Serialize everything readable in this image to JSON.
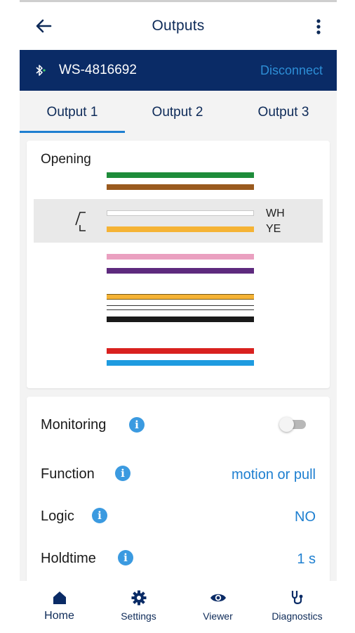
{
  "app_bar": {
    "title": "Outputs",
    "back_icon": "arrow-left-icon",
    "menu_icon": "more-vertical-icon"
  },
  "device": {
    "name": "WS-4816692",
    "action": "Disconnect",
    "icon": "bluetooth-icon"
  },
  "tabs": [
    {
      "label": "Output 1",
      "selected": true
    },
    {
      "label": "Output 2",
      "selected": false
    },
    {
      "label": "Output 3",
      "selected": false
    }
  ],
  "wiring": {
    "title": "Opening",
    "highlighted_labels": [
      "WH",
      "YE"
    ],
    "wire_colors": {
      "green": "#1e8c3a",
      "brown": "#9a5a1e",
      "white": "#ffffff",
      "yellow": "#f5b335",
      "pink": "#eaa0c0",
      "violet": "#5e2a7e",
      "black": "#1a1a1a",
      "red": "#d9211f",
      "blue": "#1e9be0"
    }
  },
  "settings": {
    "monitoring": {
      "label": "Monitoring",
      "enabled": false
    },
    "function": {
      "label": "Function",
      "value": "motion or pull"
    },
    "logic": {
      "label": "Logic",
      "value": "NO"
    },
    "holdtime": {
      "label": "Holdtime",
      "value": "1 s"
    }
  },
  "bottom_nav": [
    {
      "label": "Home",
      "icon": "home-icon",
      "active": true
    },
    {
      "label": "Settings",
      "icon": "gear-icon",
      "active": false
    },
    {
      "label": "Viewer",
      "icon": "eye-icon",
      "active": false
    },
    {
      "label": "Diagnostics",
      "icon": "stethoscope-icon",
      "active": false
    }
  ],
  "colors": {
    "primary_dark": "#0a2b66",
    "accent": "#1e7fd0",
    "background": "#f3f3f3"
  }
}
